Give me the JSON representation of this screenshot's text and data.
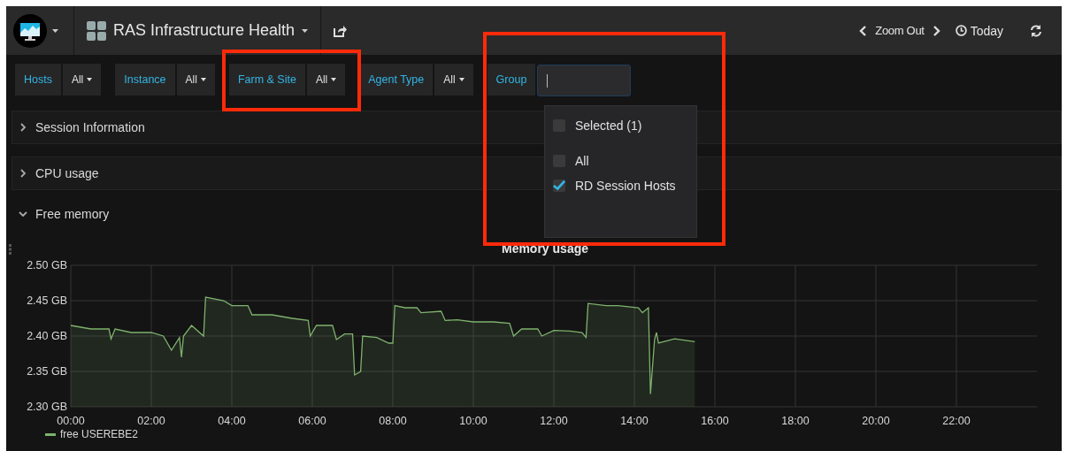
{
  "navbar": {
    "title": "RAS Infrastructure Health",
    "zoom_label": "Zoom Out",
    "time_label": "Today"
  },
  "variables": [
    {
      "kind": "select",
      "label": "Hosts",
      "value": "All"
    },
    {
      "kind": "select",
      "label": "Instance",
      "value": "All"
    },
    {
      "kind": "select",
      "label": "Farm & Site",
      "value": "All"
    },
    {
      "kind": "select",
      "label": "Agent Type",
      "value": "All"
    },
    {
      "kind": "input",
      "label": "Group",
      "focused": true
    }
  ],
  "group_dropdown": {
    "items": [
      {
        "kind": "toggle",
        "label": "Selected (1)",
        "checked": false
      },
      {
        "kind": "option",
        "label": "All",
        "checked": false
      },
      {
        "kind": "option",
        "label": "RD Session Hosts",
        "checked": true
      }
    ]
  },
  "rows": [
    {
      "title": "Session Information",
      "expanded": false
    },
    {
      "title": "CPU usage",
      "expanded": false
    },
    {
      "title": "Free memory",
      "expanded": true,
      "panel": {
        "chart_data": {
          "type": "area",
          "title": "Memory usage",
          "grid": true,
          "x": [
            0,
            0.5,
            0.95,
            1.0,
            1.1,
            1.5,
            2,
            2.3,
            2.5,
            2.7,
            2.75,
            2.8,
            3,
            3.3,
            3.35,
            3.8,
            4.0,
            4.4,
            4.5,
            5.0,
            5.5,
            5.9,
            5.95,
            6.1,
            6.5,
            6.6,
            6.8,
            7.0,
            7.05,
            7.2,
            7.25,
            7.6,
            7.9,
            8.0,
            8.05,
            8.3,
            8.6,
            8.7,
            9.2,
            9.3,
            9.6,
            10,
            10.5,
            10.9,
            11.0,
            11.2,
            11.6,
            11.7,
            12,
            12.4,
            12.7,
            12.8,
            12.85,
            13.3,
            13.6,
            14.1,
            14.2,
            14.35,
            14.4,
            14.5,
            14.55,
            14.6,
            15.0,
            15.5
          ],
          "series": [
            {
              "name": "free USEREBE2",
              "color": "#7eb26d",
              "values": [
                2.415,
                2.41,
                2.41,
                2.396,
                2.41,
                2.405,
                2.405,
                2.4,
                2.38,
                2.398,
                2.37,
                2.4,
                2.415,
                2.4,
                2.455,
                2.45,
                2.443,
                2.443,
                2.43,
                2.43,
                2.425,
                2.422,
                2.4,
                2.415,
                2.415,
                2.395,
                2.403,
                2.403,
                2.345,
                2.35,
                2.4,
                2.398,
                2.39,
                2.39,
                2.443,
                2.44,
                2.44,
                2.433,
                2.435,
                2.422,
                2.423,
                2.42,
                2.42,
                2.418,
                2.4,
                2.41,
                2.41,
                2.4,
                2.408,
                2.407,
                2.405,
                2.398,
                2.446,
                2.443,
                2.443,
                2.44,
                2.433,
                2.44,
                2.318,
                2.395,
                2.405,
                2.39,
                2.396,
                2.392
              ]
            }
          ],
          "xlim": [
            0,
            24
          ],
          "ylim": [
            2.3,
            2.5
          ],
          "xticks": [
            {
              "value": 0,
              "label": "00:00"
            },
            {
              "value": 2,
              "label": "02:00"
            },
            {
              "value": 4,
              "label": "04:00"
            },
            {
              "value": 6,
              "label": "06:00"
            },
            {
              "value": 8,
              "label": "08:00"
            },
            {
              "value": 10,
              "label": "10:00"
            },
            {
              "value": 12,
              "label": "12:00"
            },
            {
              "value": 14,
              "label": "14:00"
            },
            {
              "value": 16,
              "label": "16:00"
            },
            {
              "value": 18,
              "label": "18:00"
            },
            {
              "value": 20,
              "label": "20:00"
            },
            {
              "value": 22,
              "label": "22:00"
            }
          ],
          "yticks": [
            {
              "value": 2.3,
              "label": "2.30 GB"
            },
            {
              "value": 2.35,
              "label": "2.35 GB"
            },
            {
              "value": 2.4,
              "label": "2.40 GB"
            },
            {
              "value": 2.45,
              "label": "2.45 GB"
            },
            {
              "value": 2.5,
              "label": "2.50 GB"
            }
          ]
        }
      }
    }
  ]
}
